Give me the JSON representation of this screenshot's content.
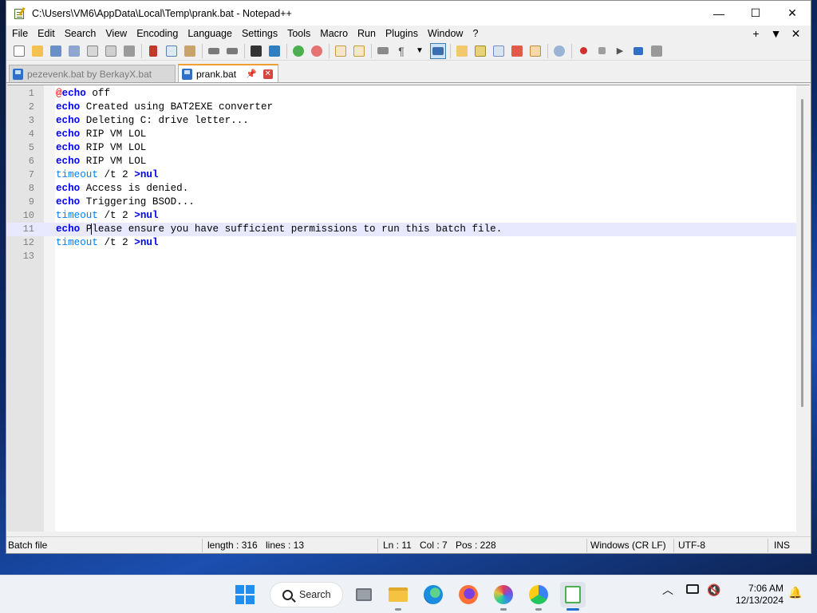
{
  "window": {
    "title": "C:\\Users\\VM6\\AppData\\Local\\Temp\\prank.bat - Notepad++",
    "minimize": "—",
    "maximize": "☐",
    "close": "✕"
  },
  "menu": {
    "items": [
      "File",
      "Edit",
      "Search",
      "View",
      "Encoding",
      "Language",
      "Settings",
      "Tools",
      "Macro",
      "Run",
      "Plugins",
      "Window",
      "?"
    ],
    "right": [
      "+",
      "▼",
      "✕"
    ]
  },
  "tabs": [
    {
      "label": "pezevenk.bat by BerkayX.bat",
      "active": false
    },
    {
      "label": "prank.bat",
      "active": true
    }
  ],
  "editor": {
    "current_line": 11,
    "lines": [
      {
        "n": "1",
        "parts": [
          [
            "op",
            "@"
          ],
          [
            "kw",
            "echo"
          ],
          [
            "t",
            " off"
          ]
        ]
      },
      {
        "n": "2",
        "parts": [
          [
            "kw",
            "echo"
          ],
          [
            "t",
            " Created using BAT2EXE converter"
          ]
        ]
      },
      {
        "n": "3",
        "parts": [
          [
            "kw",
            "echo"
          ],
          [
            "t",
            " Deleting C: drive letter..."
          ]
        ]
      },
      {
        "n": "4",
        "parts": [
          [
            "kw",
            "echo"
          ],
          [
            "t",
            " RIP VM LOL"
          ]
        ]
      },
      {
        "n": "5",
        "parts": [
          [
            "kw",
            "echo"
          ],
          [
            "t",
            " RIP VM LOL"
          ]
        ]
      },
      {
        "n": "6",
        "parts": [
          [
            "kw",
            "echo"
          ],
          [
            "t",
            " RIP VM LOL"
          ]
        ]
      },
      {
        "n": "7",
        "parts": [
          [
            "kw2",
            "timeout"
          ],
          [
            "t",
            " /t 2 "
          ],
          [
            "redir",
            ">nul"
          ]
        ]
      },
      {
        "n": "8",
        "parts": [
          [
            "kw",
            "echo"
          ],
          [
            "t",
            " Access is denied."
          ]
        ]
      },
      {
        "n": "9",
        "parts": [
          [
            "kw",
            "echo"
          ],
          [
            "t",
            " Triggering BSOD..."
          ]
        ]
      },
      {
        "n": "10",
        "parts": [
          [
            "kw2",
            "timeout"
          ],
          [
            "t",
            " /t 2 "
          ],
          [
            "redir",
            ">nul"
          ]
        ]
      },
      {
        "n": "11",
        "parts": [
          [
            "kw",
            "echo"
          ],
          [
            "t",
            " P"
          ],
          [
            "caret",
            ""
          ],
          [
            "t",
            "lease ensure you have sufficient permissions to run this batch file."
          ]
        ]
      },
      {
        "n": "12",
        "parts": [
          [
            "kw2",
            "timeout"
          ],
          [
            "t",
            " /t 2 "
          ],
          [
            "redir",
            ">nul"
          ]
        ]
      },
      {
        "n": "13",
        "parts": []
      }
    ]
  },
  "status": {
    "type": "Batch file",
    "length": "length : 316",
    "lines": "lines : 13",
    "ln": "Ln : 11",
    "col": "Col : 7",
    "pos": "Pos : 228",
    "eol": "Windows (CR LF)",
    "encoding": "UTF-8",
    "mode": "INS"
  },
  "taskbar": {
    "search_label": "Search",
    "time": "7:06 AM",
    "date": "12/13/2024"
  },
  "colors": {
    "keyword": "#0000ff",
    "command": "#0080ff",
    "operator": "#ff0000",
    "current_line_bg": "#e8e8ff",
    "active_tab_accent": "#f0a030"
  }
}
